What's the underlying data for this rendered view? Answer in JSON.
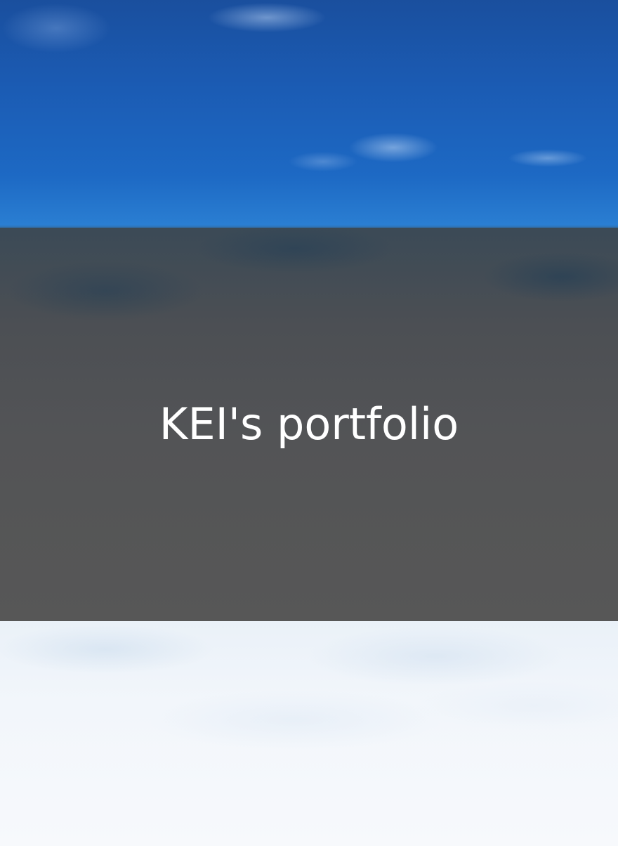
{
  "hero": {
    "title": "KEI's portfolio"
  },
  "colors": {
    "sky_top": "#1a4f9e",
    "overlay": "#555555",
    "title_text": "#ffffff",
    "clouds_bottom": "#f2f6fb"
  }
}
